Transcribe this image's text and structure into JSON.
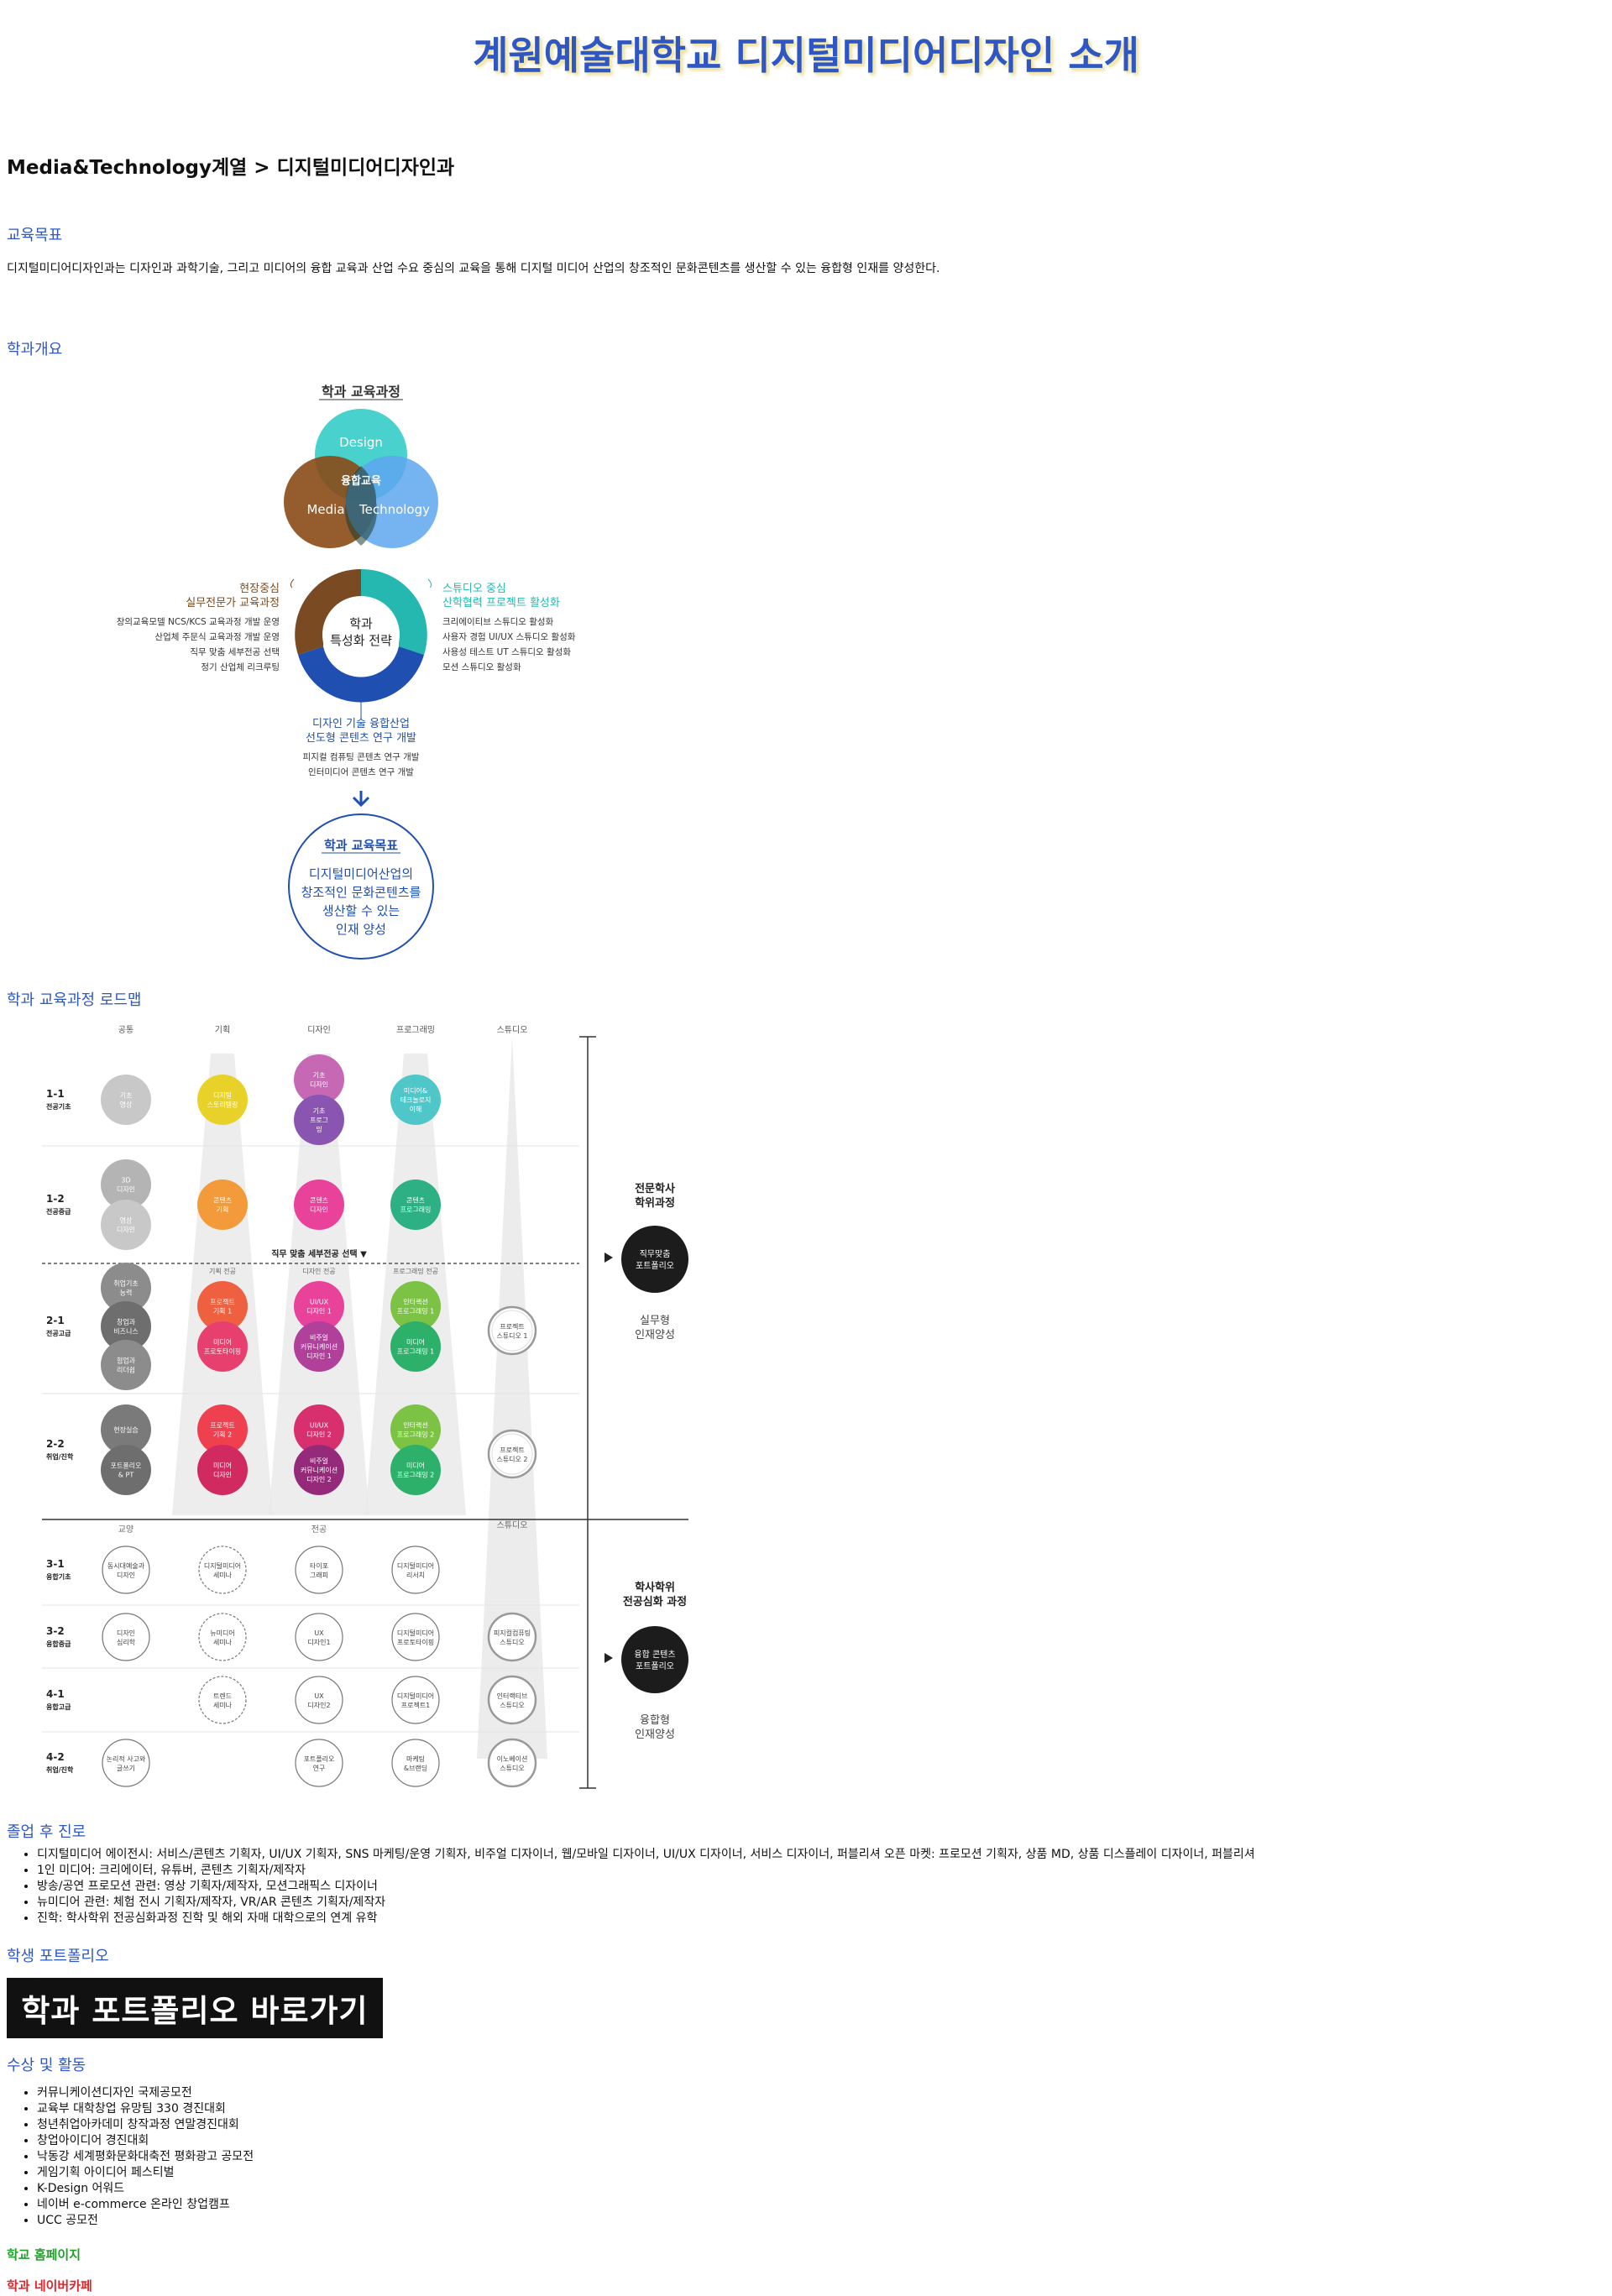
{
  "page": {
    "title": "계원예술대학교 디지털미디어디자인 소개",
    "breadcrumb": "Media&Technology계열 > 디지털미디어디자인과"
  },
  "sections": {
    "goal": {
      "heading": "교육목표",
      "text": "디지털미디어디자인과는 디자인과 과학기술, 그리고 미디어의 융합 교육과 산업 수요 중심의 교육을 통해 디지털 미디어 산업의 창조적인 문화콘텐츠를 생산할 수 있는 융합형 인재를 양성한다."
    },
    "overview": {
      "heading": "학과개요",
      "curriculum_title": "학과 교육과정",
      "venn": {
        "top": "Design",
        "left": "Media",
        "right": "Technology",
        "center": "융합교육"
      },
      "strategy_center": [
        "학과",
        "특성화 전략"
      ],
      "left_title": [
        "현장중심",
        "실무전문가 교육과정"
      ],
      "left_items": [
        "창의교육모델 NCS/KCS 교육과정 개발 운영",
        "산업체 주문식 교육과정 개발 운영",
        "직무 맞춤 세부전공 선택",
        "정기 산업체 리크루팅"
      ],
      "right_title": [
        "스튜디오 중심",
        "산학협력 프로젝트 활성화"
      ],
      "right_items": [
        "크리에이티브 스튜디오 활성화",
        "사용자 경험 UI/UX 스튜디오 활성화",
        "사용성 테스트 UT 스튜디오 활성화",
        "모션 스튜디오 활성화"
      ],
      "bottom_title": [
        "디자인 기술 융합산업",
        "선도형 콘텐츠 연구 개발"
      ],
      "bottom_items": [
        "피지컬 컴퓨팅 콘텐츠 연구 개발",
        "인터미디어 콘텐츠 연구 개발"
      ],
      "goal_title": "학과 교육목표",
      "goal_lines": [
        "디지털미디어산업의",
        "창조적인 문화콘텐츠를",
        "생산할 수 있는",
        "인재 양성"
      ]
    },
    "roadmap": {
      "heading": "학과 교육과정 로드맵",
      "columns": [
        "공통",
        "기획",
        "디자인",
        "프로그래밍",
        "스튜디오"
      ],
      "rows": [
        {
          "code": "1-1",
          "name": "전공기초"
        },
        {
          "code": "1-2",
          "name": "전공중급"
        },
        {
          "code": "2-1",
          "name": "전공고급"
        },
        {
          "code": "2-2",
          "name": "취업/진학"
        },
        {
          "code": "3-1",
          "name": "융합기초"
        },
        {
          "code": "3-2",
          "name": "융합중급"
        },
        {
          "code": "4-1",
          "name": "융합고급"
        },
        {
          "code": "4-2",
          "name": "취업/진학"
        }
      ],
      "track_select": "직무 맞춤 세부전공 선택 ▼",
      "sub_tracks": [
        "기획 전공",
        "디자인 전공",
        "프로그래밍 전공"
      ],
      "lower_groups": [
        "교양",
        "전공",
        "스튜디오"
      ],
      "associate_title": [
        "전문학사",
        "학위과정"
      ],
      "associate_circle": [
        "직무맞춤",
        "포트폴리오"
      ],
      "associate_result": [
        "실무형",
        "인재양성"
      ],
      "bachelor_title": [
        "학사학위",
        "전공심화 과정"
      ],
      "bachelor_circle": [
        "융합 콘텐츠",
        "포트폴리오"
      ],
      "bachelor_result": [
        "융합형",
        "인재양성"
      ],
      "upper_courses": [
        {
          "row": 0,
          "col": 0,
          "lines": [
            "기초",
            "영상"
          ],
          "color": "#c8c8c8"
        },
        {
          "row": 0,
          "col": 1,
          "lines": [
            "디지털",
            "스토리텔링"
          ],
          "color": "#e8d22a"
        },
        {
          "row": 0,
          "col": 2,
          "lines": [
            "기초",
            "디자인"
          ],
          "color": "#c668b4",
          "offset": -1
        },
        {
          "row": 0,
          "col": 2,
          "lines": [
            "기초",
            "프로그",
            "밍"
          ],
          "color": "#8a55b0",
          "offset": 1
        },
        {
          "row": 0,
          "col": 3,
          "lines": [
            "미디어&",
            "테크놀로지",
            "이해"
          ],
          "color": "#4fc7c9"
        },
        {
          "row": 1,
          "col": 0,
          "lines": [
            "3D",
            "디자인"
          ],
          "color": "#b4b4b4",
          "offset": -1
        },
        {
          "row": 1,
          "col": 0,
          "lines": [
            "영상",
            "디자인"
          ],
          "color": "#c8c8c8",
          "offset": 1
        },
        {
          "row": 1,
          "col": 1,
          "lines": [
            "콘텐츠",
            "기획"
          ],
          "color": "#f39a3a"
        },
        {
          "row": 1,
          "col": 2,
          "lines": [
            "콘텐츠",
            "디자인"
          ],
          "color": "#e8429a"
        },
        {
          "row": 1,
          "col": 3,
          "lines": [
            "콘텐츠",
            "프로그래밍"
          ],
          "color": "#2db083"
        },
        {
          "row": 2,
          "col": 0,
          "lines": [
            "취업기초",
            "능력"
          ],
          "color": "#8c8c8c",
          "offset": -1
        },
        {
          "row": 2,
          "col": 0,
          "lines": [
            "창업과",
            "비즈니스"
          ],
          "color": "#6e6e6e",
          "offset": 0
        },
        {
          "row": 2,
          "col": 0,
          "lines": [
            "협업과",
            "리더쉽"
          ],
          "color": "#8c8c8c",
          "offset": 1
        },
        {
          "row": 2,
          "col": 1,
          "lines": [
            "프로젝트",
            "기획 1"
          ],
          "color": "#ef6040",
          "offset": -1
        },
        {
          "row": 2,
          "col": 1,
          "lines": [
            "미디어",
            "프로토타이핑"
          ],
          "color": "#e8406e",
          "offset": 1
        },
        {
          "row": 2,
          "col": 2,
          "lines": [
            "UI/UX",
            "디자인 1"
          ],
          "color": "#e8429a",
          "offset": -1
        },
        {
          "row": 2,
          "col": 2,
          "lines": [
            "비주얼",
            "커뮤니케이션",
            "디자인 1"
          ],
          "color": "#b0409a",
          "offset": 1
        },
        {
          "row": 2,
          "col": 3,
          "lines": [
            "인터랙션",
            "프로그래밍 1"
          ],
          "color": "#7cc245",
          "offset": -1
        },
        {
          "row": 2,
          "col": 3,
          "lines": [
            "미디어",
            "프로그래밍 1"
          ],
          "color": "#2db06a",
          "offset": 1
        },
        {
          "row": 3,
          "col": 0,
          "lines": [
            "현장실습"
          ],
          "color": "#7a7a7a",
          "offset": -1
        },
        {
          "row": 3,
          "col": 0,
          "lines": [
            "포트폴리오",
            "& PT"
          ],
          "color": "#6e6e6e",
          "offset": 1
        },
        {
          "row": 3,
          "col": 1,
          "lines": [
            "프로젝트",
            "기획 2"
          ],
          "color": "#ef4050",
          "offset": -1
        },
        {
          "row": 3,
          "col": 1,
          "lines": [
            "미디어",
            "디자인"
          ],
          "color": "#d02a60",
          "offset": 1
        },
        {
          "row": 3,
          "col": 2,
          "lines": [
            "UI/UX",
            "디자인 2"
          ],
          "color": "#d8306e",
          "offset": -1
        },
        {
          "row": 3,
          "col": 2,
          "lines": [
            "비주얼",
            "커뮤니케이션",
            "디자인 2"
          ],
          "color": "#962a7a",
          "offset": 1
        },
        {
          "row": 3,
          "col": 3,
          "lines": [
            "인터랙션",
            "프로그래밍 2"
          ],
          "color": "#7cc245",
          "offset": -1
        },
        {
          "row": 3,
          "col": 3,
          "lines": [
            "미디어",
            "프로그래밍 2"
          ],
          "color": "#2db06a",
          "offset": 1
        }
      ],
      "studio_upper": [
        {
          "row": 2,
          "lines": [
            "프로젝트",
            "스튜디오 1"
          ]
        },
        {
          "row": 3,
          "lines": [
            "프로젝트",
            "스튜디오 2"
          ]
        }
      ],
      "lower_courses": [
        {
          "row": 4,
          "col": 0,
          "lines": [
            "동시대예술과",
            "디자인"
          ],
          "style": "solid"
        },
        {
          "row": 4,
          "col": 1,
          "lines": [
            "디지털미디어",
            "세미나"
          ],
          "style": "dashed"
        },
        {
          "row": 4,
          "col": 2,
          "lines": [
            "타이포",
            "그래피"
          ],
          "style": "solid"
        },
        {
          "row": 4,
          "col": 3,
          "lines": [
            "디지털미디어",
            "리서치"
          ],
          "style": "solid"
        },
        {
          "row": 5,
          "col": 0,
          "lines": [
            "디자인",
            "심리학"
          ],
          "style": "solid"
        },
        {
          "row": 5,
          "col": 1,
          "lines": [
            "뉴미디어",
            "세미나"
          ],
          "style": "dashed"
        },
        {
          "row": 5,
          "col": 2,
          "lines": [
            "UX",
            "디자인1"
          ],
          "style": "solid"
        },
        {
          "row": 5,
          "col": 3,
          "lines": [
            "디지털미디어",
            "프로토타이핑"
          ],
          "style": "solid"
        },
        {
          "row": 5,
          "col": 4,
          "lines": [
            "피지컬컴퓨팅",
            "스튜디오"
          ],
          "style": "studio"
        },
        {
          "row": 6,
          "col": 1,
          "lines": [
            "트렌드",
            "세미나"
          ],
          "style": "dashed"
        },
        {
          "row": 6,
          "col": 2,
          "lines": [
            "UX",
            "디자인2"
          ],
          "style": "solid"
        },
        {
          "row": 6,
          "col": 3,
          "lines": [
            "디지털미디어",
            "프로젝트1"
          ],
          "style": "solid"
        },
        {
          "row": 6,
          "col": 4,
          "lines": [
            "인터랙티브",
            "스튜디오"
          ],
          "style": "studio"
        },
        {
          "row": 7,
          "col": 0,
          "lines": [
            "논리적 사고와",
            "글쓰기"
          ],
          "style": "solid"
        },
        {
          "row": 7,
          "col": 2,
          "lines": [
            "포트폴리오",
            "연구"
          ],
          "style": "solid"
        },
        {
          "row": 7,
          "col": 3,
          "lines": [
            "마케팅",
            "&브랜딩"
          ],
          "style": "solid"
        },
        {
          "row": 7,
          "col": 4,
          "lines": [
            "이노베이션",
            "스튜디오"
          ],
          "style": "studio"
        }
      ]
    },
    "career": {
      "heading": "졸업 후 진로",
      "items": [
        "디지털미디어 에이전시: 서비스/콘텐츠 기획자, UI/UX 기획자, SNS 마케팅/운영 기획자, 비주얼 디자이너, 웹/모바일 디자이너, UI/UX 디자이너, 서비스 디자이너, 퍼블리셔 오픈 마켓: 프로모션 기획자, 상품 MD, 상품 디스플레이 디자이너, 퍼블리셔",
        "1인 미디어: 크리에이터, 유튜버, 콘텐츠 기획자/제작자",
        "방송/공연 프로모션 관련: 영상 기획자/제작자, 모션그래픽스 디자이너",
        "뉴미디어 관련: 체험 전시 기획자/제작자, VR/AR 콘텐츠 기획자/제작자",
        "진학: 학사학위 전공심화과정 진학 및 해외 자매 대학으로의 연계 유학"
      ]
    },
    "portfolio": {
      "heading": "학생 포트폴리오",
      "button_label": "학과 포트폴리오 바로가기"
    },
    "awards": {
      "heading": "수상 및 활동",
      "items": [
        "커뮤니케이션디자인 국제공모전",
        "교육부 대학창업 유망팀 330 경진대회",
        "청년취업아카데미 창작과정 연말경진대회",
        "창업아이디어 경진대회",
        "낙동강 세계평화문화대축전 평화광고 공모전",
        "게임기획 아이디어 페스티벌",
        "K-Design 어워드",
        "네이버 e-commerce 온라인 창업캠프",
        "UCC 공모전"
      ]
    },
    "links": {
      "homepage": "학교 홈페이지",
      "naver_cafe": "학과 네이버카페"
    }
  },
  "colors": {
    "accent": "#2e57c4",
    "venn_design": "#3ecfca",
    "venn_media": "#8a4a17",
    "venn_technology": "#5ea6ef",
    "donut_left": "#7a4b22",
    "donut_right": "#24b8b0",
    "donut_bottom": "#1f4fb0",
    "link_green": "#1fa02b",
    "link_red": "#e0242b"
  }
}
